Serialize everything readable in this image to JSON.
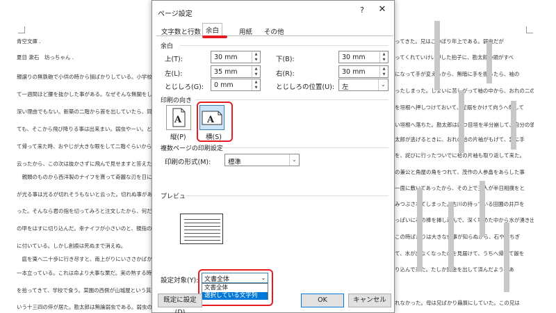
{
  "document": {
    "left_lines": [
      "青空文庫 .",
      "夏目 漱石　坊っちゃん .",
      "",
      "親譲りの無鉄砲で小供の時から損ばかりしている。小学校に",
      "て一週間ほど腰を抜かした事がある。なぜそんな無闇をした",
      "深い理由でもない。新築の二階から首を出していたら、同級",
      "ても、そこから飛び降りる事は出来まい。弱虫やーい。と囃",
      "て帰って来た時、おやじが大きな眼をして二階ぐらいから飛",
      "云ったから、この次は抜かさずに飛んで見せますと答えた。",
      "　親類のものから西洋製のナイフを貰って奇麗な刃を日に翳",
      "が光る事は光るが切れそうもないと云った。切れぬ事がある",
      "った。そんなら君の指を切ってみろと注文したから、何だ指",
      "の甲をはすに切り込んだ。幸ナイフが小さいのと、親指の骨",
      "に付いている。しかし創痕は死ぬまで消えぬ。",
      "　庭を東へ二十歩に行き尽すと、南上がりにいささかばかりの",
      "一本立っている。これは命より大事な栗だ。実の熟する時分は",
      "を拾ってきて、学校で食う。菜園の西側が山城屋という質屋の",
      "いう十三四の倅が居た。勘太郎は無論弱虫である。弱虫の癖に"
    ],
    "right_lines": [
      "",
      "ってきた。兄はごつぼり年上である。弱虫だが",
      "ってくれていけい押した拍子に、勘太郎の頭がすべ",
      "になって手が変えるから、無暗に手を振ったら、袖の",
      "ったしまった。しまいに苦しがって袖の中から、おれの二の",
      "を垣根へ押しつけておいて、足搦をかけて向うへ倒して",
      "い垣根へ落ちた。勘太郎は四つ目垣を半分崩して、自分の領",
      "太郎が逃げるときに、おれの袷の片袖がもげて、急に手",
      "を、詫びに行ったついでに袷の片袖も取り返して来た。",
      "",
      "の兼公と角屋の角をつれて、茂作の人参畠をあらした事",
      "一面に敷いてあったから、その上で三人が半日相撲をと",
      "みつぶされてしまった。古川の持っている田圃の井戸を",
      "っぱいに石の棒を挿し込んで、深く埋めた中から水が湧き出て、",
      "この時ばかりは大きな仕事が知らぬから、石や棒ちぎ",
      "て、水が出なくなったのを見届けて、うちへ帰って飯を",
      "り込んで来た。たしか罰金を出して済んだようであ",
      "",
      "れなかった。母は兄ばかり贔屓にしていた。この兄は"
    ]
  },
  "dialog": {
    "title": "ページ設定",
    "help": "?",
    "close": "✕",
    "tabs": [
      "文字数と行数",
      "余白",
      "用紙",
      "その他"
    ],
    "active_tab": "余白",
    "margins": {
      "section_title": "余白",
      "top_label": "上(T):",
      "top_value": "30 mm",
      "bottom_label": "下(B):",
      "bottom_value": "30 mm",
      "left_label": "左(L):",
      "left_value": "35 mm",
      "right_label": "右(R):",
      "right_value": "30 mm",
      "gutter_label": "とじしろ(G):",
      "gutter_value": "0 mm",
      "gutter_pos_label": "とじしろの位置(U):",
      "gutter_pos_value": "左"
    },
    "orientation": {
      "section_title": "印刷の向き",
      "portrait_label": "縦(P)",
      "landscape_label": "横(S)",
      "selected": "landscape",
      "glyph": "A"
    },
    "pages": {
      "section_title": "複数ページの印刷設定",
      "format_label": "印刷の形式(M):",
      "format_value": "標準"
    },
    "preview": {
      "section_title": "プレビュー"
    },
    "apply": {
      "label": "設定対象(Y):",
      "value": "文書全体",
      "options": [
        "文書全体",
        "選択している文字列"
      ],
      "highlighted": "選択している文字列"
    },
    "buttons": {
      "default": "既定に設定(D)",
      "ok": "OK",
      "cancel": "キャンセル"
    }
  },
  "colors": {
    "highlight_frame": "#e51c23",
    "selection": "#0078d7",
    "selected_tile": "#cce4f7"
  }
}
